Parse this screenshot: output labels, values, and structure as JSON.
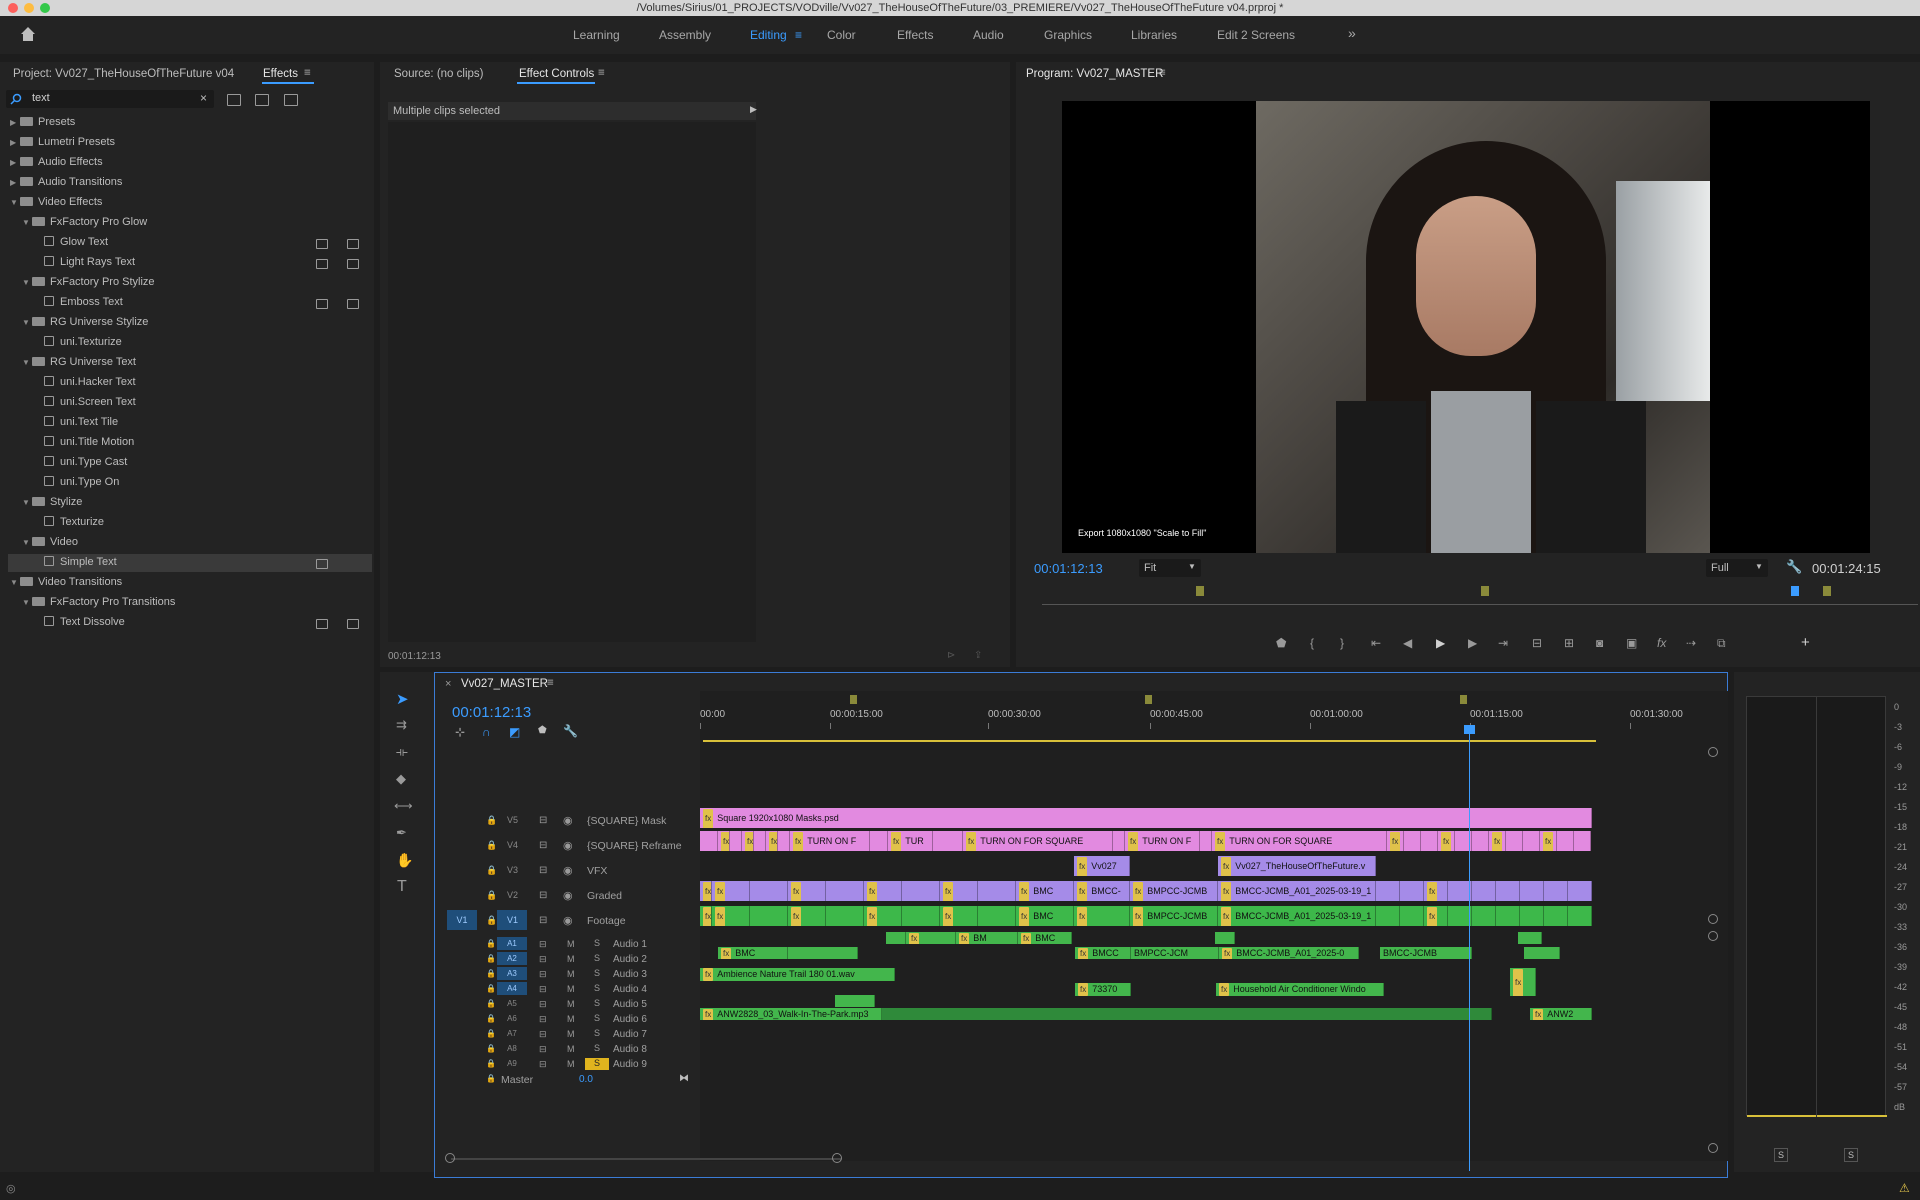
{
  "window": {
    "title": "/Volumes/Sirius/01_PROJECTS/VODville/Vv027_TheHouseOfTheFuture/03_PREMIERE/Vv027_TheHouseOfTheFuture v04.prproj *"
  },
  "workspaces": [
    "Learning",
    "Assembly",
    "Editing",
    "Color",
    "Effects",
    "Audio",
    "Graphics",
    "Libraries",
    "Edit 2 Screens"
  ],
  "active_workspace": "Editing",
  "overflow_label": "»",
  "project_panel": {
    "project_tab": "Project: Vv027_TheHouseOfTheFuture v04",
    "effects_tab": "Effects",
    "search_value": "text",
    "tree": [
      {
        "label": "Presets",
        "depth": 0,
        "kind": "folder",
        "expanded": false
      },
      {
        "label": "Lumetri Presets",
        "depth": 0,
        "kind": "folder",
        "expanded": false
      },
      {
        "label": "Audio Effects",
        "depth": 0,
        "kind": "folder",
        "expanded": false
      },
      {
        "label": "Audio Transitions",
        "depth": 0,
        "kind": "folder",
        "expanded": false
      },
      {
        "label": "Video Effects",
        "depth": 0,
        "kind": "folder",
        "expanded": true
      },
      {
        "label": "FxFactory Pro Glow",
        "depth": 1,
        "kind": "folder",
        "expanded": true
      },
      {
        "label": "Glow Text",
        "depth": 2,
        "kind": "effect",
        "badges": 2
      },
      {
        "label": "Light Rays Text",
        "depth": 2,
        "kind": "effect",
        "badges": 2
      },
      {
        "label": "FxFactory Pro Stylize",
        "depth": 1,
        "kind": "folder",
        "expanded": true
      },
      {
        "label": "Emboss Text",
        "depth": 2,
        "kind": "effect",
        "badges": 2
      },
      {
        "label": "RG Universe Stylize",
        "depth": 1,
        "kind": "folder",
        "expanded": true
      },
      {
        "label": "uni.Texturize",
        "depth": 2,
        "kind": "effect",
        "badges": 0
      },
      {
        "label": "RG Universe Text",
        "depth": 1,
        "kind": "folder",
        "expanded": true
      },
      {
        "label": "uni.Hacker Text",
        "depth": 2,
        "kind": "effect",
        "badges": 0
      },
      {
        "label": "uni.Screen Text",
        "depth": 2,
        "kind": "effect",
        "badges": 0
      },
      {
        "label": "uni.Text Tile",
        "depth": 2,
        "kind": "effect",
        "badges": 0
      },
      {
        "label": "uni.Title Motion",
        "depth": 2,
        "kind": "effect",
        "badges": 0
      },
      {
        "label": "uni.Type Cast",
        "depth": 2,
        "kind": "effect",
        "badges": 0
      },
      {
        "label": "uni.Type On",
        "depth": 2,
        "kind": "effect",
        "badges": 0
      },
      {
        "label": "Stylize",
        "depth": 1,
        "kind": "folder",
        "expanded": true
      },
      {
        "label": "Texturize",
        "depth": 2,
        "kind": "effect",
        "badges": 0
      },
      {
        "label": "Video",
        "depth": 1,
        "kind": "folder",
        "expanded": true
      },
      {
        "label": "Simple Text",
        "depth": 2,
        "kind": "effect",
        "badges": 1,
        "selected": true
      },
      {
        "label": "Video Transitions",
        "depth": 0,
        "kind": "folder",
        "expanded": true
      },
      {
        "label": "FxFactory Pro Transitions",
        "depth": 1,
        "kind": "folder",
        "expanded": true
      },
      {
        "label": "Text Dissolve",
        "depth": 2,
        "kind": "transition",
        "badges": 2
      }
    ]
  },
  "source_panel": {
    "source_tab": "Source: (no clips)",
    "effect_controls_tab": "Effect Controls",
    "message": "Multiple clips selected",
    "timecode": "00:01:12:13"
  },
  "program_monitor": {
    "tab": "Program: Vv027_MASTER",
    "overlay_text": "Export 1080x1080 \"Scale to Fill\"",
    "timecode": "00:01:12:13",
    "fit": "Fit",
    "quality": "Full",
    "duration": "00:01:24:15"
  },
  "timeline": {
    "tab": "Vv027_MASTER",
    "timecode": "00:01:12:13",
    "ruler": [
      "00:00",
      "00:00:15:00",
      "00:00:30:00",
      "00:00:45:00",
      "00:01:00:00",
      "00:01:15:00",
      "00:01:30:00"
    ],
    "video_tracks": [
      {
        "id": "V5",
        "name": "{SQUARE} Mask"
      },
      {
        "id": "V4",
        "name": "{SQUARE} Reframe"
      },
      {
        "id": "V3",
        "name": "VFX"
      },
      {
        "id": "V2",
        "name": "Graded"
      },
      {
        "id": "V1",
        "name": "Footage",
        "source": "V1"
      }
    ],
    "audio_tracks": [
      {
        "id": "A1",
        "name": "Audio 1"
      },
      {
        "id": "A2",
        "name": "Audio 2"
      },
      {
        "id": "A3",
        "name": "Audio 3"
      },
      {
        "id": "A4",
        "name": "Audio 4"
      },
      {
        "id": "A5",
        "name": "Audio 5"
      },
      {
        "id": "A6",
        "name": "Audio 6"
      },
      {
        "id": "A7",
        "name": "Audio 7"
      },
      {
        "id": "A8",
        "name": "Audio 8"
      },
      {
        "id": "A9",
        "name": "Audio 9"
      }
    ],
    "master": {
      "name": "Master",
      "value": "0.0"
    },
    "mute_label": "M",
    "solo_label": "S",
    "clip_labels": {
      "v5": "Square 1920x1080 Masks.psd",
      "v4a": "TURN ON F",
      "v4b": "TUR",
      "v4c": "TURN ON FOR SQUARE",
      "v4d": "TURN ON F",
      "v4e": "TURN ON FOR SQUARE",
      "v3a": "Vv027",
      "v3b": "Vv027_TheHouseOfTheFuture.v",
      "v2a": "BMC",
      "v2b": "BMCC-",
      "v2c": "BMPCC-JCMB",
      "v2d": "BMCC-JCMB_A01_2025-03-19_1",
      "v1a": "BMC",
      "v1b": "BMPCC-JCMB",
      "v1c": "BMCC-JCMB_A01_2025-03-19_1",
      "a1a": "BM",
      "a1b": "BMC",
      "a2a": "BMC",
      "a2b": "BMCC",
      "a2c": "BMPCC-JCM",
      "a2d": "BMCC-JCMB_A01_2025-0",
      "a2e": "BMCC-JCMB",
      "a5": "Ambience Nature Trail 180 01.wav",
      "a6a": "73370",
      "a6b": "Household Air Conditioner Windo",
      "a8a": "ANW2828_03_Walk-In-The-Park.mp3",
      "a8b": "ANW2"
    }
  },
  "meter": {
    "scale": [
      "0",
      "-3",
      "-6",
      "-9",
      "-12",
      "-15",
      "-18",
      "-21",
      "-24",
      "-27",
      "-30",
      "-33",
      "-36",
      "-39",
      "-42",
      "-45",
      "-48",
      "-51",
      "-54",
      "-57",
      "dB"
    ],
    "solo_labels": [
      "S",
      "S"
    ]
  }
}
